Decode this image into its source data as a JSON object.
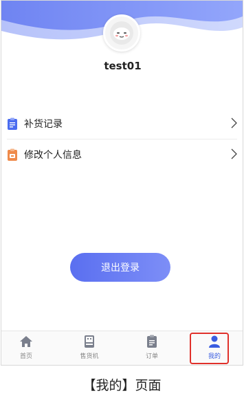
{
  "user": {
    "name": "test01"
  },
  "menu": [
    {
      "label": "补货记录",
      "icon": "clipboard-icon"
    },
    {
      "label": "修改个人信息",
      "icon": "profile-card-icon"
    }
  ],
  "logout_label": "退出登录",
  "tabs": [
    {
      "label": "首页",
      "icon": "home-icon",
      "active": false
    },
    {
      "label": "售货机",
      "icon": "vending-machine-icon",
      "active": false
    },
    {
      "label": "订单",
      "icon": "order-icon",
      "active": false
    },
    {
      "label": "我的",
      "icon": "person-icon",
      "active": true
    }
  ],
  "caption": "【我的】页面",
  "colors": {
    "accent": "#3a5ce0",
    "highlight": "#e0302a"
  }
}
